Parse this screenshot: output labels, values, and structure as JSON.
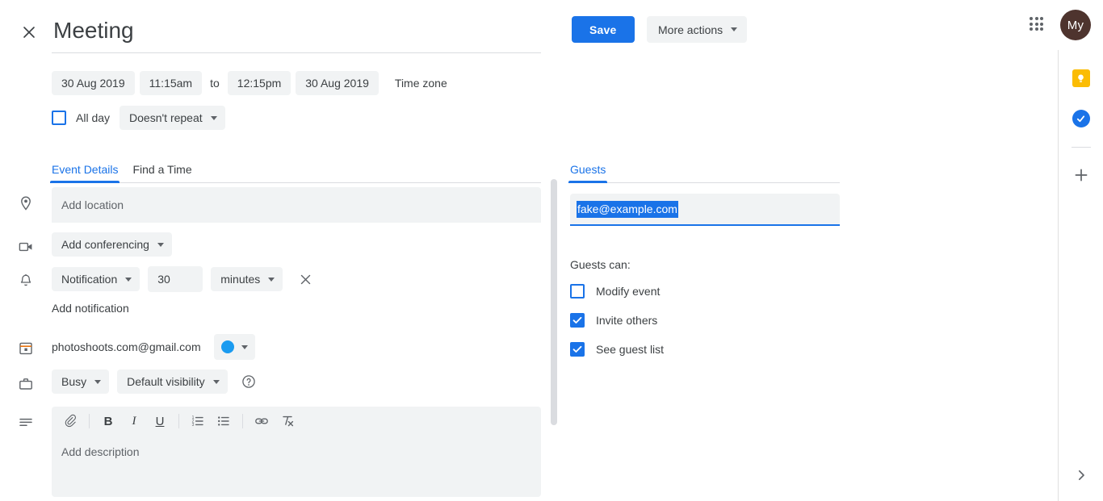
{
  "header": {
    "close_icon": "close-icon",
    "title": "Meeting",
    "save_label": "Save",
    "more_actions_label": "More actions",
    "apps_icon": "apps-grid-icon",
    "avatar_initials": "My"
  },
  "schedule": {
    "start_date": "30 Aug 2019",
    "start_time": "11:15am",
    "to_label": "to",
    "end_time": "12:15pm",
    "end_date": "30 Aug 2019",
    "time_zone_label": "Time zone",
    "all_day_label": "All day",
    "all_day_checked": false,
    "repeat_label": "Doesn't repeat"
  },
  "tabs": {
    "left": [
      {
        "label": "Event Details",
        "active": true
      },
      {
        "label": "Find a Time",
        "active": false
      }
    ],
    "right": [
      {
        "label": "Guests",
        "active": true
      }
    ]
  },
  "details": {
    "location_placeholder": "Add location",
    "location_value": "",
    "conferencing_label": "Add conferencing",
    "notification_type": "Notification",
    "notification_value": "30",
    "notification_unit": "minutes",
    "remove_notification_icon": "close-icon",
    "add_notification_label": "Add notification",
    "calendar_email": "photoshoots.com@gmail.com",
    "event_color": "#1a9bf0",
    "busy_label": "Busy",
    "visibility_label": "Default visibility",
    "help_icon": "help-circle-icon"
  },
  "description": {
    "toolbar": [
      {
        "name": "attach-icon",
        "glyph": "attach"
      },
      {
        "name": "bold-icon",
        "glyph": "B"
      },
      {
        "name": "italic-icon",
        "glyph": "I"
      },
      {
        "name": "underline-icon",
        "glyph": "U"
      },
      {
        "name": "numbered-list-icon",
        "glyph": "ol"
      },
      {
        "name": "bulleted-list-icon",
        "glyph": "ul"
      },
      {
        "name": "insert-link-icon",
        "glyph": "link"
      },
      {
        "name": "remove-formatting-icon",
        "glyph": "clear"
      }
    ],
    "placeholder": "Add description",
    "value": ""
  },
  "guests": {
    "input_value": "fake@example.com",
    "input_selected": true,
    "guests_can_label": "Guests can:",
    "permissions": [
      {
        "label": "Modify event",
        "checked": false
      },
      {
        "label": "Invite others",
        "checked": true
      },
      {
        "label": "See guest list",
        "checked": true
      }
    ]
  },
  "right_rail": {
    "items": [
      {
        "name": "google-keep-icon",
        "label": "Keep"
      },
      {
        "name": "google-tasks-icon",
        "label": "Tasks"
      }
    ],
    "add_label": "+",
    "expand_icon": "chevron-right-icon"
  },
  "colors": {
    "accent": "#1a73e8",
    "chip_bg": "#f1f3f4",
    "text": "#3c4043",
    "muted": "#5f6368",
    "avatar_bg": "#4e342e",
    "keep_yellow": "#fbbc04"
  }
}
